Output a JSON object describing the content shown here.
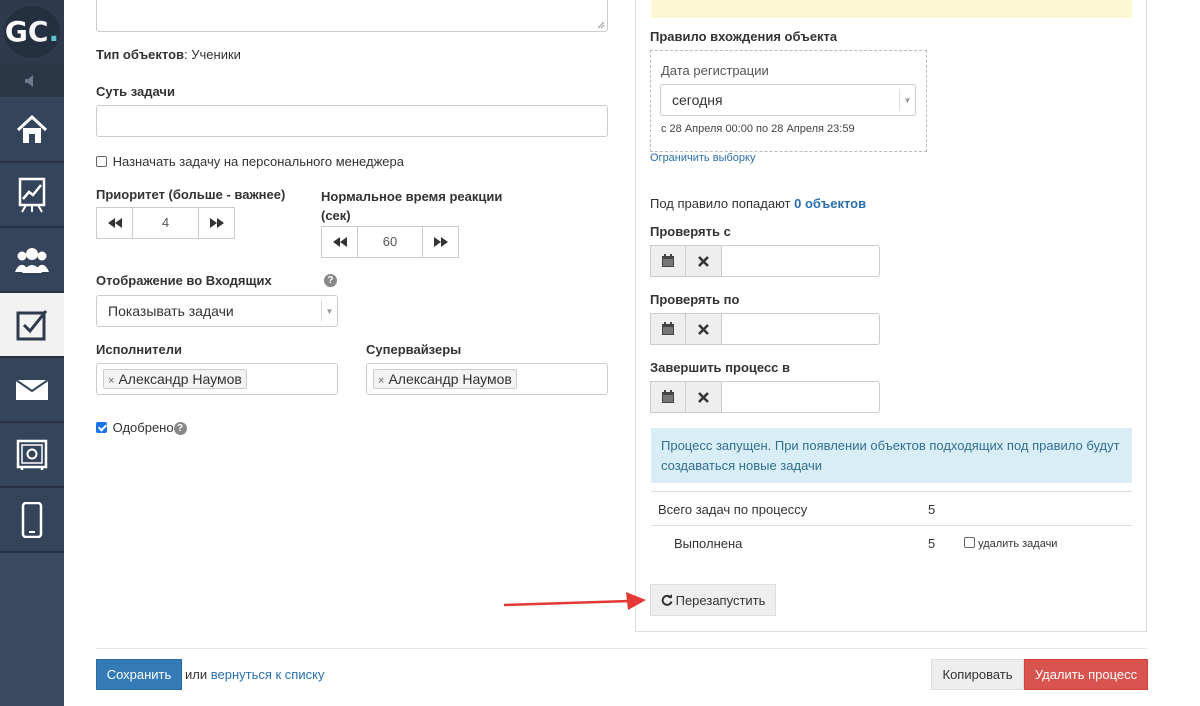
{
  "sidebar": {
    "logo": {
      "g": "G",
      "c": "C",
      "dot": "."
    },
    "items": [
      {
        "name": "home-icon",
        "active": false
      },
      {
        "name": "chart-icon",
        "active": false
      },
      {
        "name": "users-icon",
        "active": false
      },
      {
        "name": "tasks-checkbox-icon",
        "active": true
      },
      {
        "name": "mail-icon",
        "active": false
      },
      {
        "name": "safe-icon",
        "active": false
      },
      {
        "name": "mobile-icon",
        "active": false
      }
    ]
  },
  "form": {
    "description_text": "",
    "object_type_label": "Тип объектов",
    "object_type_value": ": Ученики",
    "task_essence_label": "Суть задачи",
    "task_essence_value": "",
    "assign_personal_manager_label": "Назначать задачу на персонального менеджера",
    "assign_personal_manager_checked": false,
    "priority_label": "Приоритет (больше - важнее)",
    "priority_value": "4",
    "reaction_time_label_line1": "Нормальное время реакции",
    "reaction_time_label_line2": "(сек)",
    "reaction_time_value": "60",
    "inbox_display_label": "Отображение во Входящих",
    "inbox_display_value": "Показывать задачи",
    "executors_label": "Исполнители",
    "executors": [
      "Александр Наумов"
    ],
    "supervisors_label": "Супервайзеры",
    "supervisors": [
      "Александр Наумов"
    ],
    "approved_label": "Одобрено",
    "approved_checked": true
  },
  "right": {
    "yellow_note": "",
    "rule_title": "Правило вхождения объекта",
    "reg_date_label": "Дата регистрации",
    "reg_date_value": "сегодня",
    "reg_date_range": "с 28 Апреля 00:00 по 28 Апреля 23:59",
    "limit_link": "Ограничить выборку",
    "matches_prefix": "Под правило попадают ",
    "matches_link": "0 объектов",
    "check_from_label": "Проверять с",
    "check_to_label": "Проверять по",
    "finish_label": "Завершить процесс в",
    "info_text": "Процесс запущен. При появлении объектов подходящих под правило будут создаваться новые задачи",
    "total_tasks_label": "Всего задач по процессу",
    "total_tasks_value": "5",
    "done_label": "Выполнена",
    "done_value": "5",
    "delete_tasks_label": "удалить задачи",
    "restart_label": "Перезапустить"
  },
  "footer": {
    "save_label": "Сохранить",
    "or_text": "или",
    "back_link": "вернуться к списку",
    "copy_label": "Копировать",
    "delete_label": "Удалить процесс"
  },
  "colors": {
    "sidebar": "#2f3b4c",
    "primary": "#337ab7",
    "danger": "#d9534f",
    "info_bg": "#d9edf7",
    "annotation_arrow": "#e53935"
  }
}
